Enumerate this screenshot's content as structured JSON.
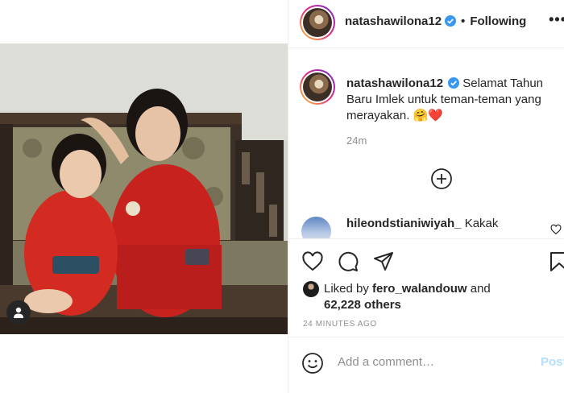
{
  "post": {
    "author": "natashawilona12",
    "follow_status": "Following",
    "more_label": "•••",
    "separator": "•",
    "caption_text": "Selamat Tahun Baru Imlek untuk teman-teman yang merayakan.",
    "caption_emojis": "🤗❤️",
    "caption_age": "24m",
    "likes": {
      "prefix": "Liked by",
      "user": "fero_walandouw",
      "joiner": "and",
      "count_text": "62,228 others"
    },
    "timestamp": "24 MINUTES AGO"
  },
  "comments": [
    {
      "user": "hileondstianiwiyah_",
      "text": "Kakak"
    }
  ],
  "composer": {
    "placeholder": "Add a comment…",
    "post_label": "Post"
  },
  "icons": {
    "verified": "verified-badge-icon",
    "like": "heart-outline-icon",
    "comment": "speech-bubble-icon",
    "share": "paper-plane-icon",
    "save": "bookmark-icon",
    "load_more": "plus-circle-icon",
    "emoji": "smiley-icon",
    "user_tag": "user-tag-icon"
  },
  "colors": {
    "verified": "#3897f0",
    "post_disabled": "#b2dffc",
    "muted": "#8e8e8e",
    "border": "#efefef"
  }
}
